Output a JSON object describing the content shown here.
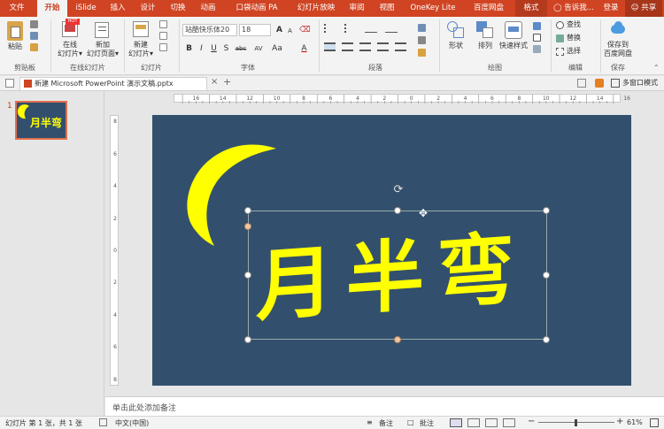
{
  "ribbon_tabs": [
    "文件",
    "开始",
    "iSlide",
    "插入",
    "设计",
    "切换",
    "动画",
    "口袋动画 PA",
    "幻灯片放映",
    "审阅",
    "视图",
    "OneKey Lite",
    "百度网盘",
    "格式"
  ],
  "tellme": "告诉我...",
  "login": "登录",
  "share": "共享",
  "groups": {
    "clipboard": {
      "label": "剪贴板",
      "paste": "粘贴"
    },
    "online_slides": {
      "label": "在线幻灯片",
      "online": "在线",
      "online2": "幻灯片▾",
      "new_page": "新加",
      "new_page2": "幻灯页面▾",
      "hot": "HOT"
    },
    "slides": {
      "label": "幻灯片",
      "new": "新建",
      "new2": "幻灯片▾"
    },
    "font": {
      "label": "字体",
      "font_name": "站酷快乐体20",
      "font_size": "18",
      "bold": "B",
      "italic": "I",
      "underline": "U",
      "strike": "S",
      "abc": "abc",
      "av": "AV",
      "aa": "Aa",
      "grow": "A",
      "shrink": "A",
      "color_a": "A"
    },
    "paragraph": {
      "label": "段落"
    },
    "drawing": {
      "label": "绘图",
      "shape": "形状",
      "arrange": "排列",
      "quick_style": "快速样式"
    },
    "editing": {
      "label": "编辑",
      "find": "查找",
      "replace": "替换",
      "select": "选择"
    },
    "save": {
      "label": "保存",
      "save_to": "保存到",
      "baidu": "百度网盘"
    }
  },
  "doc_tab": {
    "title": "新建 Microsoft PowerPoint 演示文稿.pptx",
    "close": "×",
    "add": "+",
    "multiwin": "多窗口模式"
  },
  "thumbnail": {
    "number": "1",
    "text": "月半弯"
  },
  "slide": {
    "title_text": "月半弯",
    "bg_color": "#32506d",
    "text_color": "#ffff00",
    "moon_color": "#ffff00"
  },
  "ruler": {
    "h_labels": [
      "16",
      "14",
      "12",
      "10",
      "8",
      "6",
      "4",
      "2",
      "0",
      "2",
      "4",
      "6",
      "8",
      "10",
      "12",
      "14",
      "16"
    ],
    "v_labels": [
      "8",
      "6",
      "4",
      "2",
      "0",
      "2",
      "4",
      "6",
      "8"
    ]
  },
  "notes": {
    "placeholder": "单击此处添加备注"
  },
  "status": {
    "slide_info": "幻灯片 第 1 张，共 1 张",
    "language": "中文(中国)",
    "notes_btn": "备注",
    "comments_btn": "批注",
    "zoom": "61%",
    "minus": "−",
    "plus": "+"
  }
}
